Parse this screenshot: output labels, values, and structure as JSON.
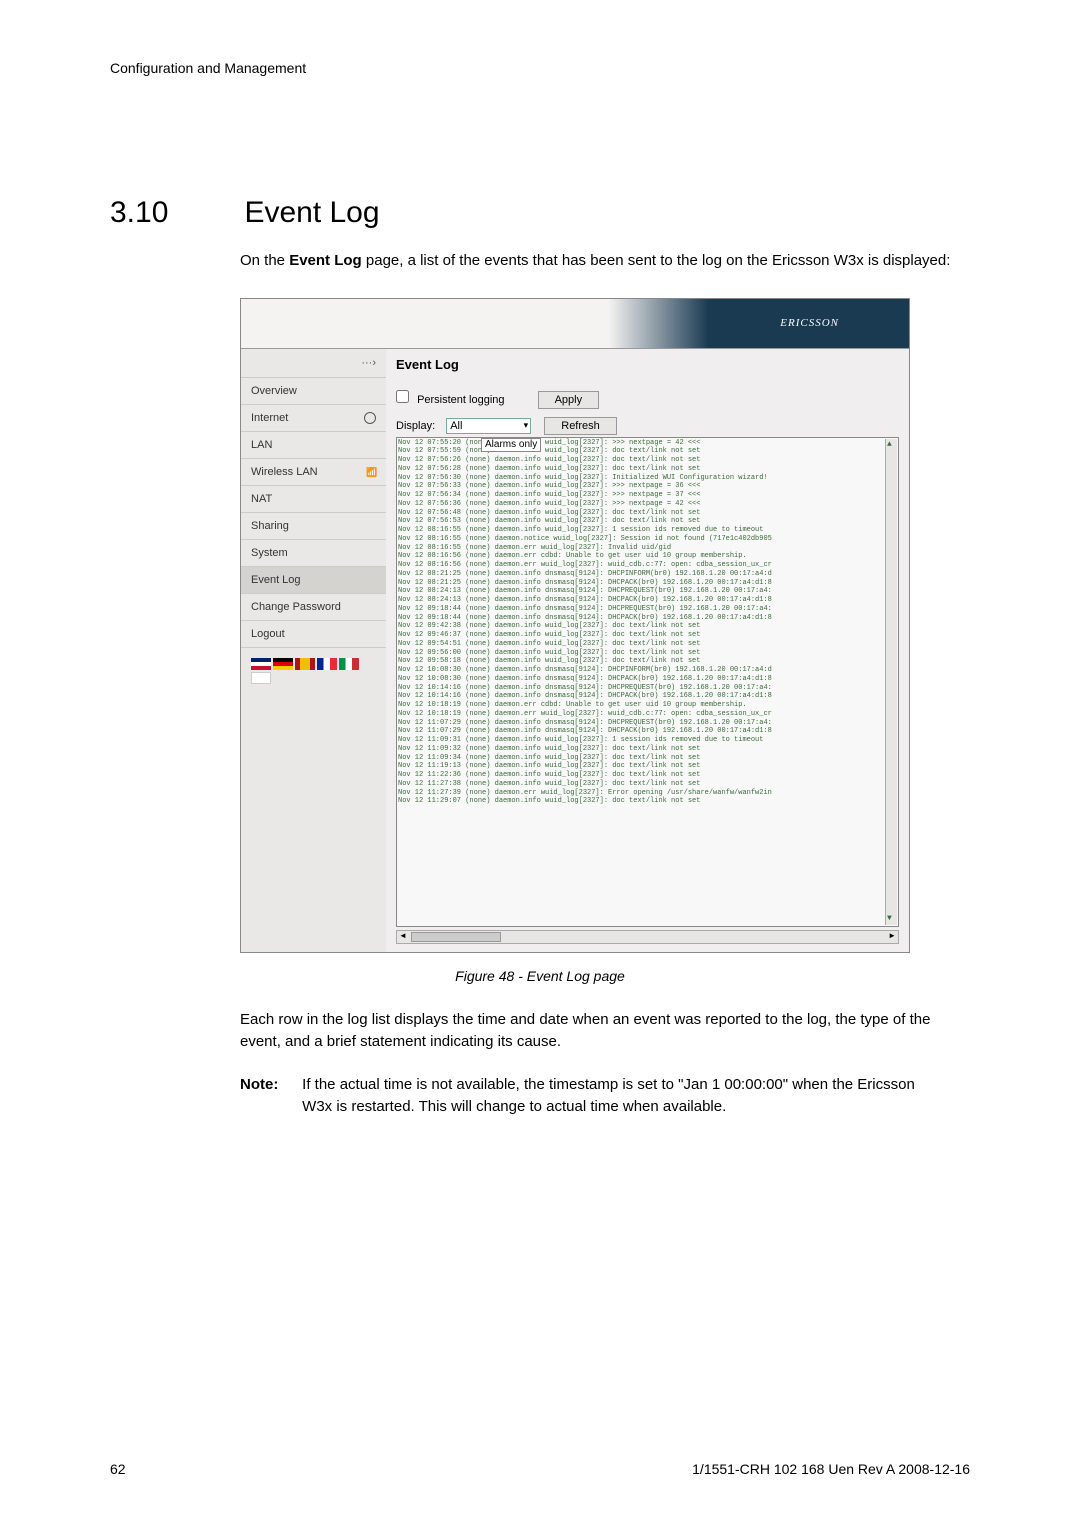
{
  "header": "Configuration and Management",
  "section": {
    "num": "3.10",
    "title": "Event Log"
  },
  "intro_pre": "On the ",
  "intro_bold": "Event Log",
  "intro_post": " page, a list of the events that has been sent to the log on the Ericsson W3x is displayed:",
  "screenshot": {
    "brand": "ERICSSON",
    "arrow": "···›",
    "nav": [
      "Overview",
      "Internet",
      "LAN",
      "Wireless LAN",
      "NAT",
      "Sharing",
      "System",
      "Event Log",
      "Change Password",
      "Logout"
    ],
    "title": "Event Log",
    "persist": "Persistent logging",
    "apply_btn": "Apply",
    "display_lbl": "Display:",
    "display_val": "All",
    "refresh_btn": "Refresh",
    "dd_opt1": "All",
    "dd_opt2": "Alarms only",
    "log_lines": [
      "Nov 12 07:55:20 (none) daemon.info wuid_log[2327]: >>> nextpage = 42 <<<",
      "Nov 12 07:55:59 (none) daemon.info wuid_log[2327]: doc text/link not set",
      "Nov 12 07:56:26 (none) daemon.info wuid_log[2327]: doc text/link not set",
      "Nov 12 07:56:28 (none) daemon.info wuid_log[2327]: doc text/link not set",
      "Nov 12 07:56:30 (none) daemon.info wuid_log[2327]:  Initialized WUI Configuration wizard!",
      "Nov 12 07:56:33 (none) daemon.info wuid_log[2327]: >>> nextpage = 36 <<<",
      "Nov 12 07:56:34 (none) daemon.info wuid_log[2327]: >>> nextpage = 37 <<<",
      "Nov 12 07:56:36 (none) daemon.info wuid_log[2327]: >>> nextpage = 42 <<<",
      "Nov 12 07:56:48 (none) daemon.info wuid_log[2327]: doc text/link not set",
      "Nov 12 07:56:53 (none) daemon.info wuid_log[2327]: doc text/link not set",
      "Nov 12 08:16:55 (none) daemon.info wuid_log[2327]: 1 session ids removed due to timeout",
      "Nov 12 08:16:55 (none) daemon.notice wuid_log[2327]: Session id not found (717e1c402db905",
      "Nov 12 08:16:55 (none) daemon.err wuid_log[2327]: Invalid uid/gid",
      "Nov 12 08:16:56 (none) daemon.err cdbd: Unable to get user uid 10 group membership.",
      "Nov 12 08:16:56 (none) daemon.err wuid_log[2327]: wuid_cdb.c:77: open: cdba_session_ux_cr",
      "Nov 12 08:21:25 (none) daemon.info dnsmasq[9124]: DHCPINFORM(br0) 192.168.1.20 00:17:a4:d",
      "Nov 12 08:21:25 (none) daemon.info dnsmasq[9124]: DHCPACK(br0) 192.168.1.20 00:17:a4:d1:8",
      "Nov 12 08:24:13 (none) daemon.info dnsmasq[9124]: DHCPREQUEST(br0) 192.168.1.20 00:17:a4:",
      "Nov 12 08:24:13 (none) daemon.info dnsmasq[9124]: DHCPACK(br0) 192.168.1.20 00:17:a4:d1:8",
      "Nov 12 09:18:44 (none) daemon.info dnsmasq[9124]: DHCPREQUEST(br0) 192.168.1.20 00:17:a4:",
      "Nov 12 09:18:44 (none) daemon.info dnsmasq[9124]: DHCPACK(br0) 192.168.1.20 00:17:a4:d1:8",
      "Nov 12 09:42:38 (none) daemon.info wuid_log[2327]: doc text/link not set",
      "Nov 12 09:46:37 (none) daemon.info wuid_log[2327]: doc text/link not set",
      "Nov 12 09:54:51 (none) daemon.info wuid_log[2327]: doc text/link not set",
      "Nov 12 09:56:00 (none) daemon.info wuid_log[2327]: doc text/link not set",
      "Nov 12 09:58:18 (none) daemon.info wuid_log[2327]: doc text/link not set",
      "Nov 12 10:08:30 (none) daemon.info dnsmasq[9124]: DHCPINFORM(br0) 192.168.1.20 00:17:a4:d",
      "Nov 12 10:08:30 (none) daemon.info dnsmasq[9124]: DHCPACK(br0) 192.168.1.20 00:17:a4:d1:8",
      "Nov 12 10:14:16 (none) daemon.info dnsmasq[9124]: DHCPREQUEST(br0) 192.168.1.20 00:17:a4:",
      "Nov 12 10:14:16 (none) daemon.info dnsmasq[9124]: DHCPACK(br0) 192.168.1.20 00:17:a4:d1:8",
      "Nov 12 10:18:19 (none) daemon.err cdbd: Unable to get user uid 10 group membership.",
      "Nov 12 10:18:19 (none) daemon.err wuid_log[2327]: wuid_cdb.c:77: open: cdba_session_ux_cr",
      "Nov 12 11:07:29 (none) daemon.info dnsmasq[9124]: DHCPREQUEST(br0) 192.168.1.20 00:17:a4:",
      "Nov 12 11:07:29 (none) daemon.info dnsmasq[9124]: DHCPACK(br0) 192.168.1.20 00:17:a4:d1:8",
      "Nov 12 11:09:31 (none) daemon.info wuid_log[2327]: 1 session ids removed due to timeout",
      "Nov 12 11:09:32 (none) daemon.info wuid_log[2327]: doc text/link not set",
      "Nov 12 11:09:34 (none) daemon.info wuid_log[2327]: doc text/link not set",
      "Nov 12 11:19:13 (none) daemon.info wuid_log[2327]: doc text/link not set",
      "Nov 12 11:22:36 (none) daemon.info wuid_log[2327]: doc text/link not set",
      "Nov 12 11:27:38 (none) daemon.info wuid_log[2327]: doc text/link not set",
      "Nov 12 11:27:39 (none) daemon.err wuid_log[2327]: Error opening /usr/share/wanfw/wanfw2in",
      "Nov 12 11:29:07 (none) daemon.info wuid_log[2327]: doc text/link not set"
    ]
  },
  "caption": "Figure 48 - Event Log page",
  "para2": "Each row in the log list displays the time and date when an event was reported to the log, the type of the event, and a brief statement indicating its cause.",
  "note_lbl": "Note:",
  "note_txt": "If the actual time is not available, the timestamp is set to \"Jan 1 00:00:00\" when the Ericsson W3x is restarted. This will change to actual time when available.",
  "footer": {
    "page": "62",
    "doc": "1/1551-CRH 102 168 Uen Rev A  2008-12-16"
  }
}
